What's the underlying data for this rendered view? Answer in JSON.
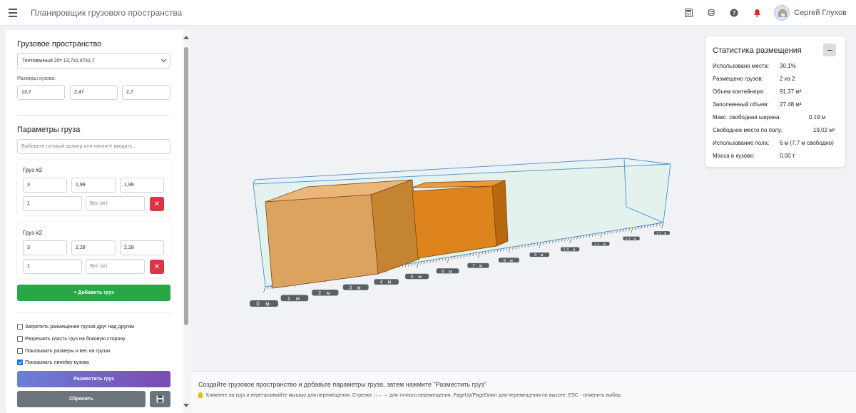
{
  "app": {
    "title": "Планировщик грузового пространства",
    "user_name": "Сергей Глухов"
  },
  "sidebar": {
    "space_section_title": "Грузовое пространство",
    "vehicle_select": "Тентованный 20т 13,7x2,47x2,7",
    "body_dims_label": "Размеры кузова:",
    "body_dims": [
      "13,7",
      "2,47",
      "2,7"
    ],
    "cargo_section_title": "Параметры груза",
    "cargo_search_placeholder": "Выберите готовый размер или начните вводить...",
    "cargo_items": [
      {
        "title": "Груз #2",
        "length": "3",
        "width": "1,99",
        "height": "1,99",
        "quantity": "1",
        "weight_placeholder": "Вес (кг)"
      },
      {
        "title": "Груз #2",
        "length": "3",
        "width": "2,28",
        "height": "2,28",
        "quantity": "1",
        "weight_placeholder": "Вес (кг)"
      }
    ],
    "add_cargo_label": "+ Добавить груз",
    "options": [
      {
        "label": "Запретить размещение грузов друг над другом",
        "checked": false
      },
      {
        "label": "Разрешить класть груз на боковую сторону",
        "checked": false
      },
      {
        "label": "Показывать размеры и вес на грузах",
        "checked": false
      },
      {
        "label": "Показывать линейку кузова",
        "checked": true
      }
    ],
    "place_button": "Разместить груз",
    "reset_button": "Сбросить"
  },
  "stats": {
    "title": "Статистика размещения",
    "rows": [
      {
        "label": "Использовано места:",
        "value": "30.1%"
      },
      {
        "label": "Размещено грузов:",
        "value": "2 из 2"
      },
      {
        "label": "Объем контейнера:",
        "value": "91.37 м³"
      },
      {
        "label": "Заполненный объем:",
        "value": "27.48 м³"
      },
      {
        "label": "Макс. свободная ширина:",
        "value": "0.19 м"
      },
      {
        "label": "Свободное место по полу:",
        "value": "19.02 м²"
      },
      {
        "label": "Использование пола:",
        "value": "6 м (7,7 м свободно)"
      },
      {
        "label": "Масса в кузове:",
        "value": "0.00 т"
      }
    ]
  },
  "ruler": {
    "labels": [
      "0 м",
      "1 м",
      "2 м",
      "3 м",
      "4 м",
      "5 м",
      "6 м",
      "7 м",
      "8 м",
      "9 м",
      "10 м",
      "11 м",
      "12 м",
      "13 м"
    ]
  },
  "bottom": {
    "main_text": "Создайте грузовое пространство и добавьте параметры груза, затем нажмите \"Разместить груз\"",
    "hint_text": "Кликните на груз и перетаскивайте мышью для перемещения. Стрелки ↑↓←→ для точного перемещения. PageUp/PageDown для перемещения по высоте. ESC - отменить выбор."
  },
  "colors": {
    "cargo_light": "#d9a25a",
    "cargo_dark": "#de841c",
    "container_edge": "#4a8fd0",
    "container_fill": "#dff0e8",
    "add_green": "#28a745",
    "delete_red": "#dc3545"
  },
  "icons": [
    "menu-icon",
    "calculator-icon",
    "coins-icon",
    "help-icon",
    "bell-icon",
    "close-icon",
    "save-icon",
    "lightbulb-icon",
    "minus-icon"
  ]
}
